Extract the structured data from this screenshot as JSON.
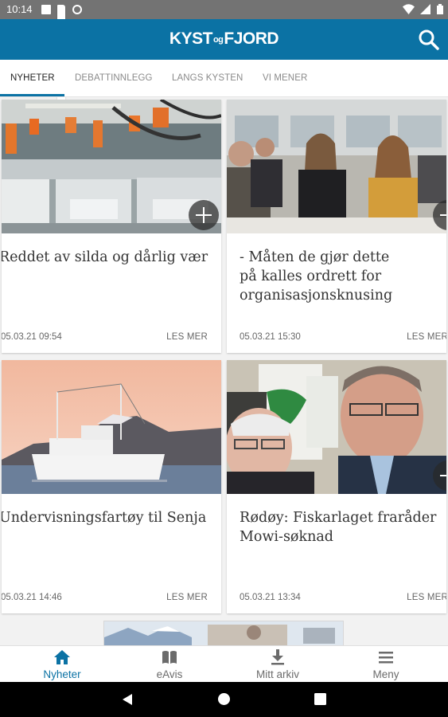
{
  "status_bar": {
    "time": "10:14",
    "icons": [
      "notification-square-icon",
      "sd-card-icon",
      "sync-icon",
      "wifi-icon",
      "signal-icon",
      "battery-icon"
    ]
  },
  "app_bar": {
    "logo_part1": "KYST",
    "logo_part2": "og",
    "logo_part3": "FJORD",
    "search_icon": "search-icon"
  },
  "tabs": [
    {
      "label": "NYHETER",
      "active": true
    },
    {
      "label": "DEBATTINNLEGG",
      "active": false
    },
    {
      "label": "LANGS KYSTEN",
      "active": false
    },
    {
      "label": "VI MENER",
      "active": false
    }
  ],
  "articles": [
    {
      "title_lines": [
        "Reddet av silda og dårlig vær"
      ],
      "date": "05.03.21 09:54",
      "more_label": "LES MER"
    },
    {
      "title_lines": [
        "- Måten de gjør dette",
        "på kalles ordrett for",
        "organisasjonsknusing"
      ],
      "date": "05.03.21 15:30",
      "more_label": "LES MER"
    },
    {
      "title_lines": [
        "Undervisningsfartøy til Senja"
      ],
      "date": "05.03.21 14:46",
      "more_label": "LES MER"
    },
    {
      "title_lines": [
        "Rødøy: Fiskarlaget fraråder",
        "Mowi-søknad"
      ],
      "date": "05.03.21 13:34",
      "more_label": "LES MER"
    }
  ],
  "bottom_nav": [
    {
      "label": "Nyheter",
      "icon": "home-icon",
      "active": true
    },
    {
      "label": "eAvis",
      "icon": "book-icon",
      "active": false
    },
    {
      "label": "Mitt arkiv",
      "icon": "download-icon",
      "active": false
    },
    {
      "label": "Meny",
      "icon": "menu-icon",
      "active": false
    }
  ],
  "colors": {
    "brand": "#0b72a4",
    "status_bar": "#737373"
  }
}
